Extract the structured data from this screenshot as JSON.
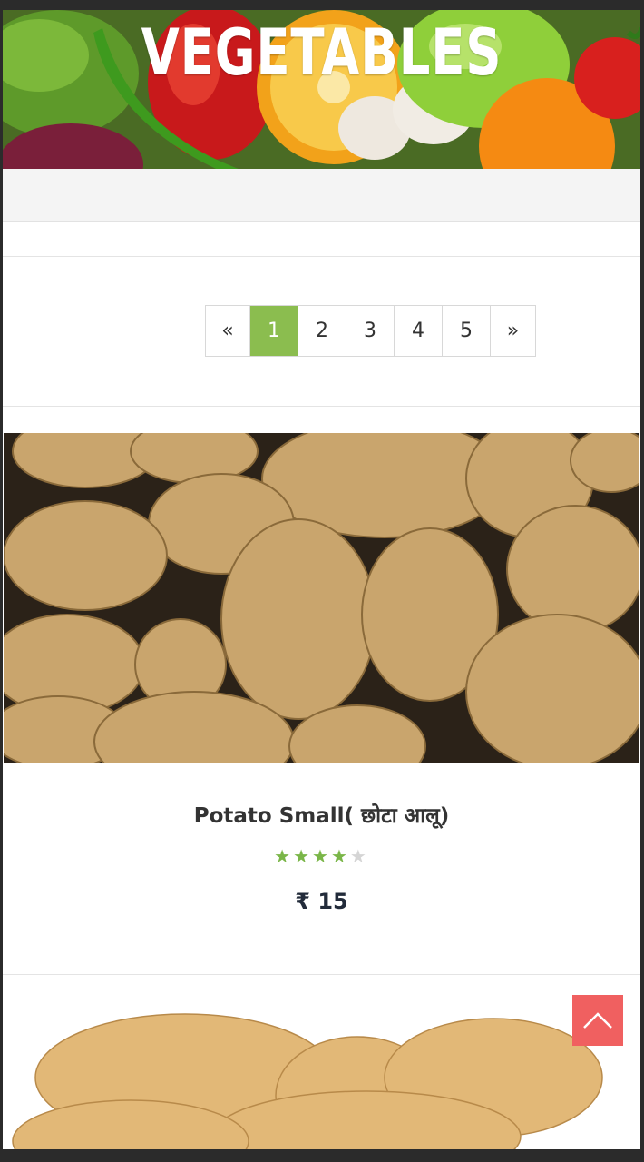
{
  "banner": {
    "title": "VEGETABLES"
  },
  "pagination": {
    "prev_label": "«",
    "pages": [
      "1",
      "2",
      "3",
      "4",
      "5"
    ],
    "active_page": "1",
    "next_label": "»",
    "active_color": "#8bbd4f"
  },
  "product": {
    "name": "Potato Small( छोटा आलू)",
    "rating": 4,
    "rating_max": 5,
    "price": "₹ 15"
  },
  "scroll_top": {
    "icon": "chevron-up-icon",
    "color": "#f06060"
  }
}
